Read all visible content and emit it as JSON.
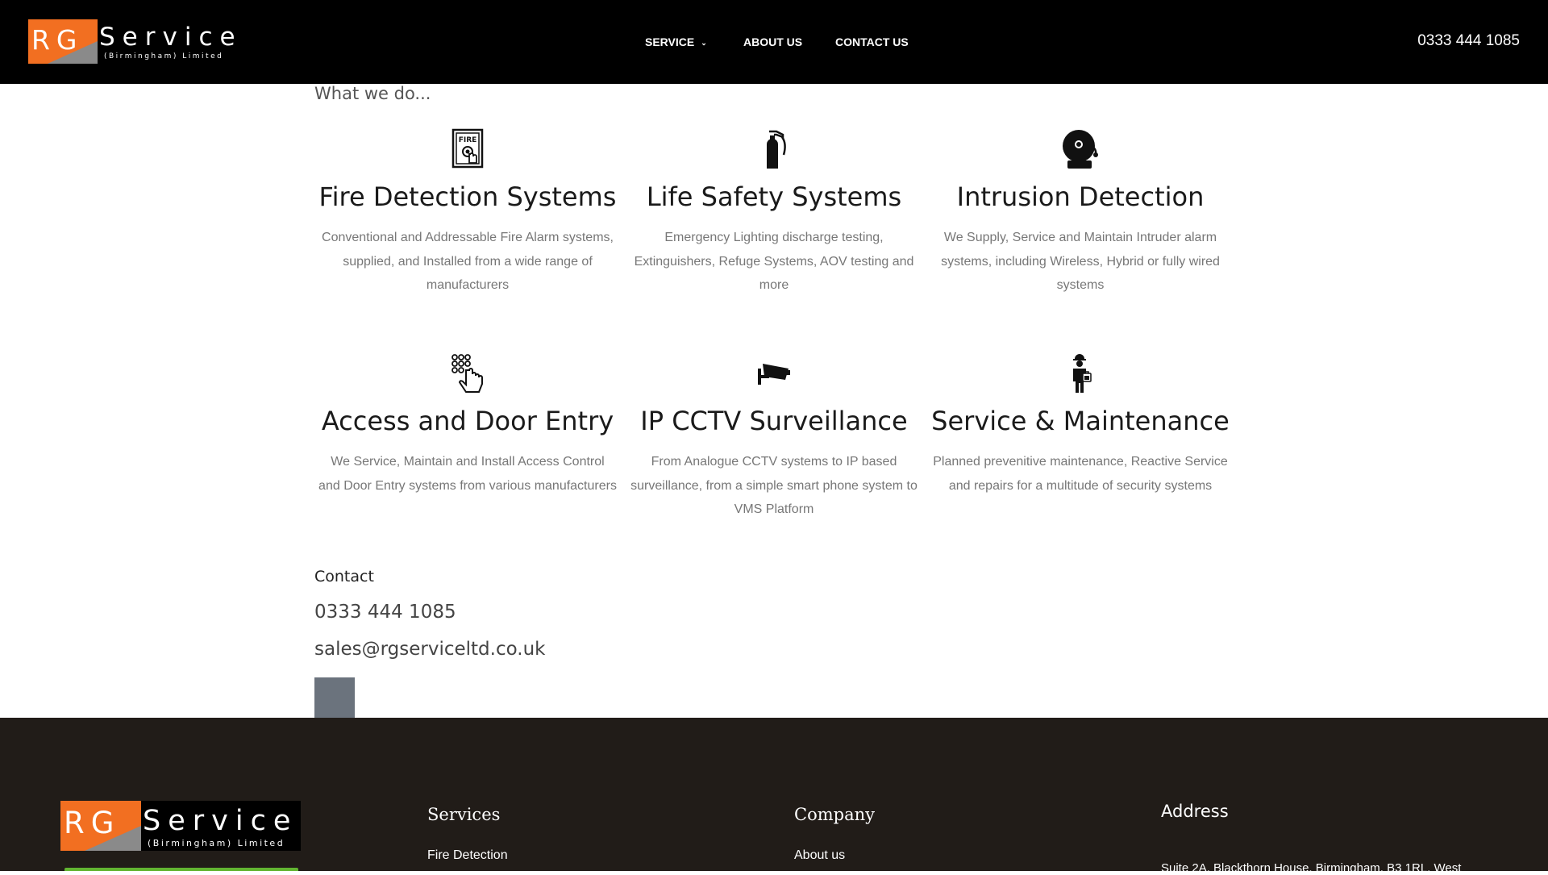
{
  "header": {
    "logo": {
      "mark": "RG",
      "word": "Service",
      "sub": "(Birmingham) Limited"
    },
    "nav": [
      {
        "label": "SERVICE",
        "chevron": "⌄"
      },
      {
        "label": "ABOUT US"
      },
      {
        "label": "CONTACT US"
      }
    ],
    "phone": "0333 444 1085"
  },
  "main": {
    "section_title": "What we do...",
    "services": [
      {
        "icon": "fire-alarm-icon",
        "title": "Fire Detection Systems",
        "text": "Conventional and Addressable Fire Alarm systems, supplied, and Installed from a wide range of manufacturers"
      },
      {
        "icon": "fire-extinguisher-icon",
        "title": "Life Safety Systems",
        "text": "Emergency Lighting discharge testing, Extinguishers, Refuge Systems, AOV testing and more"
      },
      {
        "icon": "alarm-bell-icon",
        "title": "Intrusion Detection",
        "text": "We Supply, Service and Maintain Intruder alarm systems, including Wireless, Hybrid or fully wired systems"
      },
      {
        "icon": "keypad-icon",
        "title": "Access and Door Entry",
        "text": "We Service, Maintain and Install Access Control and Door Entry systems from various manufacturers"
      },
      {
        "icon": "cctv-camera-icon",
        "title": "IP CCTV Surveillance",
        "text": "From Analogue CCTV systems to IP based surveillance, from a simple smart phone system to VMS Platform"
      },
      {
        "icon": "engineer-icon",
        "title": "Service & Maintenance",
        "text": "Planned prevenitive maintenance, Reactive Service and repairs for a multitude of security systems"
      }
    ],
    "contact": {
      "title": "Contact",
      "phone": "0333 444 1085",
      "email": "sales@rgserviceltd.co.uk"
    }
  },
  "footer": {
    "logo": {
      "mark": "RG",
      "word": "Service",
      "sub": "(Birmingham) Limited"
    },
    "services_title": "Services",
    "services_link": "Fire Detection",
    "company_title": "Company",
    "company_link": "About us",
    "address_title": "Address",
    "address_text": "Suite 2A, Blackthorn House, Birmingham, B3 1RL, West"
  },
  "colors": {
    "brand_orange": "#f26f21",
    "header_bg": "#000000",
    "footer_bg": "#211c18",
    "accent_green": "#62b531"
  }
}
